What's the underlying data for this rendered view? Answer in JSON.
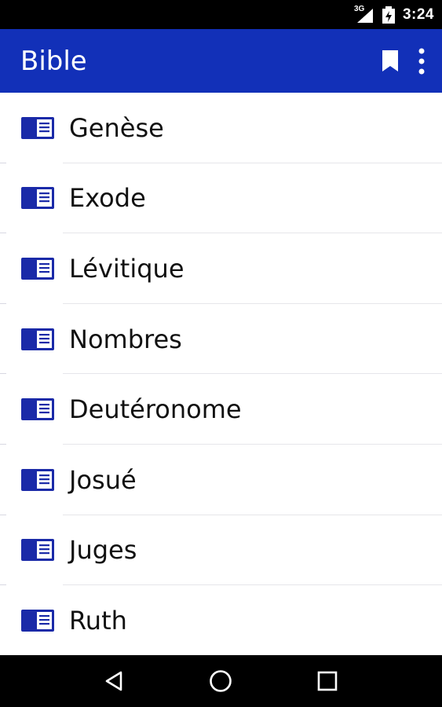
{
  "status_bar": {
    "network": "3G",
    "time": "3:24",
    "icons": [
      "signal-icon",
      "battery-charging-icon"
    ]
  },
  "app_bar": {
    "title": "Bible",
    "actions": [
      "bookmark-icon",
      "overflow-menu-icon"
    ]
  },
  "books": [
    {
      "label": "Genèse",
      "icon": "book-icon"
    },
    {
      "label": "Exode",
      "icon": "book-icon"
    },
    {
      "label": "Lévitique",
      "icon": "book-icon"
    },
    {
      "label": "Nombres",
      "icon": "book-icon"
    },
    {
      "label": "Deutéronome",
      "icon": "book-icon"
    },
    {
      "label": "Josué",
      "icon": "book-icon"
    },
    {
      "label": "Juges",
      "icon": "book-icon"
    },
    {
      "label": "Ruth",
      "icon": "book-icon"
    }
  ],
  "nav_bar": {
    "buttons": [
      "back-icon",
      "home-icon",
      "recents-icon"
    ]
  },
  "colors": {
    "primary": "#1230b8",
    "icon": "#1a2aa8",
    "status_bar": "#000000",
    "nav_bar": "#000000"
  }
}
